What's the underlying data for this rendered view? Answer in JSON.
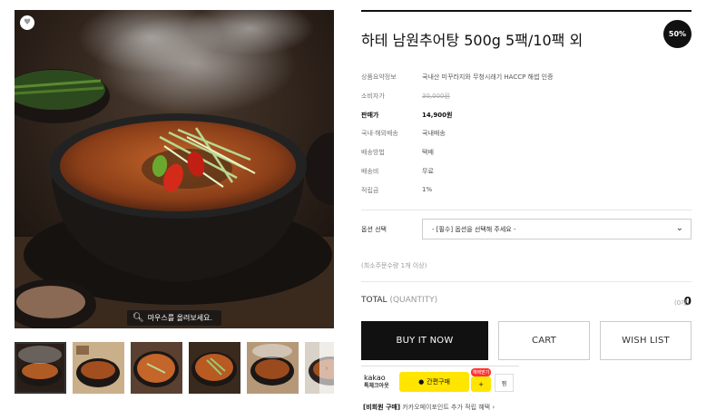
{
  "product": {
    "title": "하테 남원추어탕 500g 5팩/10팩 외",
    "discount_badge": "50%",
    "zoom_hint": "마우스를 올려보세요.",
    "info": [
      {
        "label": "상품요약정보",
        "value": "국내산 미꾸라지와 무청시래기 HACCP 해썹 인증",
        "style": "normal"
      },
      {
        "label": "소비자가",
        "value": "30,000원",
        "style": "strike"
      },
      {
        "label": "판매가",
        "value": "14,900원",
        "style": "bold"
      },
      {
        "label": "국내·해외배송",
        "value": "국내배송",
        "style": "normal"
      },
      {
        "label": "배송방법",
        "value": "택배",
        "style": "normal"
      },
      {
        "label": "배송비",
        "value": "무료",
        "style": "normal"
      },
      {
        "label": "적립금",
        "value": "1%",
        "style": "normal"
      }
    ]
  },
  "options": {
    "label": "옵션 선택",
    "select_value": "- [필수] 옵션을 선택해 주세요 -",
    "min_qty_note": "(최소주문수량 1개 이상)"
  },
  "total": {
    "label": "TOTAL",
    "quantity_label": "(QUANTITY)",
    "value": "0",
    "unit": "(0개)"
  },
  "buttons": {
    "buy": "BUY IT NOW",
    "cart": "CART",
    "wish": "WISH LIST"
  },
  "kakao": {
    "brand": "kakao",
    "brand_sub": "톡체크아웃",
    "pay_label": "간편구매",
    "benefit_badge": "혜택받기",
    "plus_label": "+",
    "share_label": "찜",
    "nonmember_prefix": "[비회원 구매]",
    "nonmember_text": "카카오페이포인트 추가 적립 혜택"
  },
  "thumbnails": [
    "thumb-1",
    "thumb-2",
    "thumb-3",
    "thumb-4",
    "thumb-5",
    "thumb-6"
  ],
  "icons": {
    "heart": "heart-icon",
    "zoom": "magnifier-icon",
    "chevron": "chevron-down-icon",
    "arrow": "chevron-right-icon"
  }
}
